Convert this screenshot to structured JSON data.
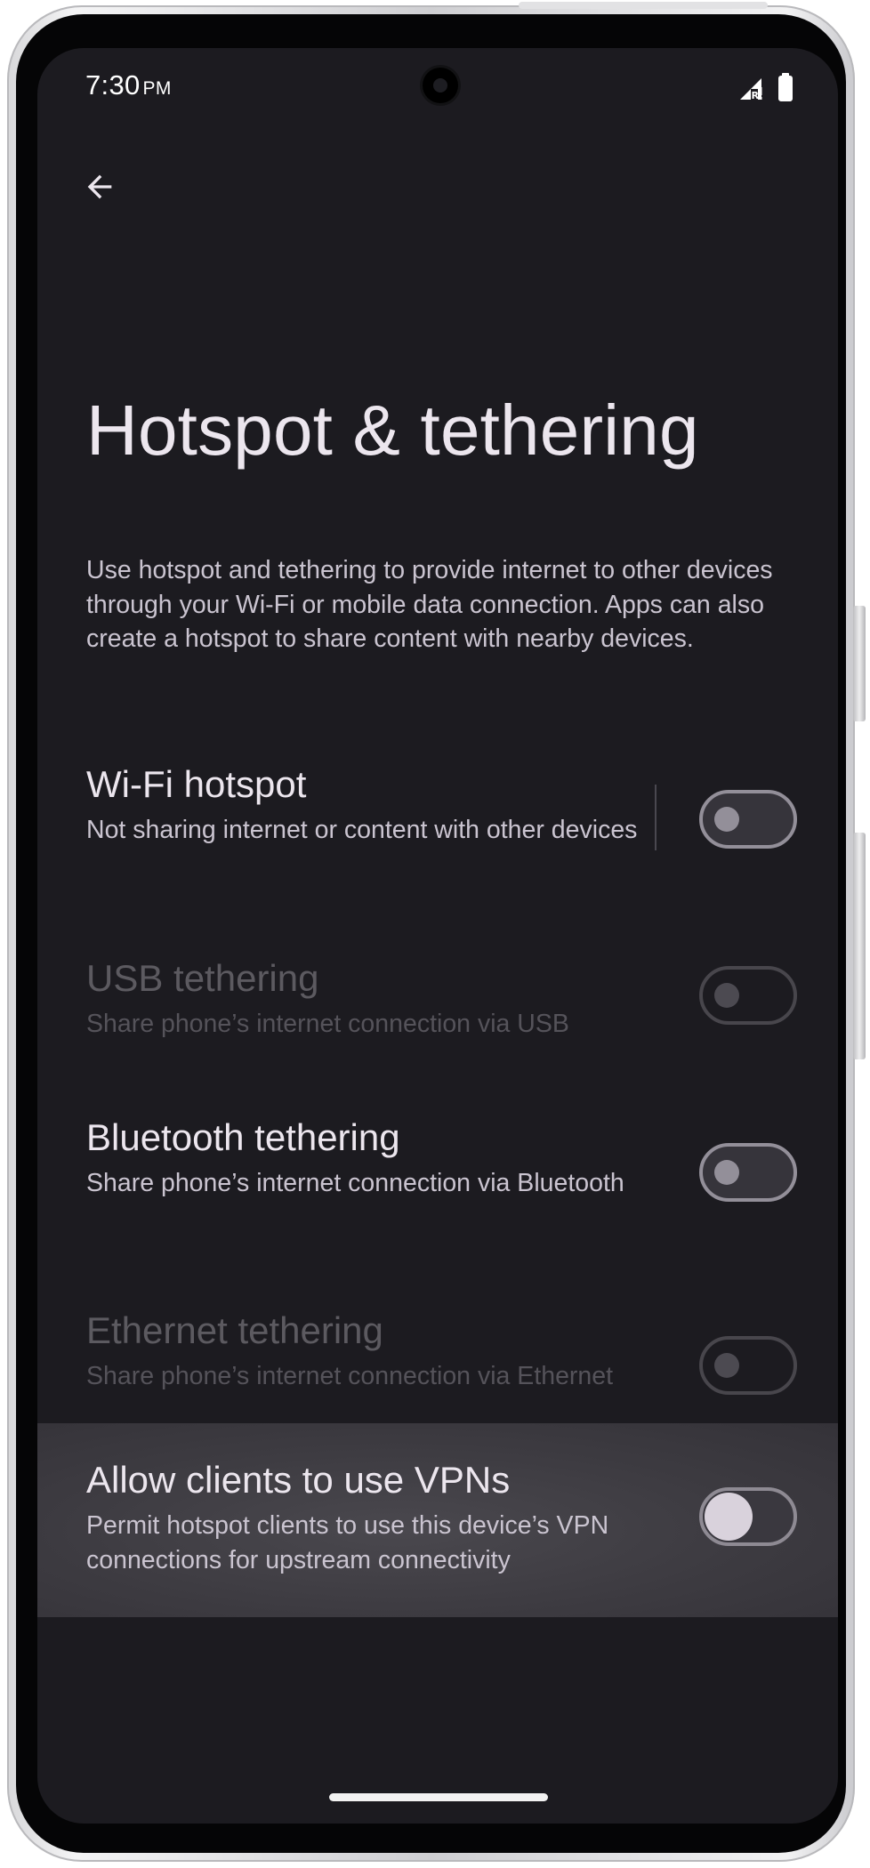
{
  "status_bar": {
    "time": "7:30",
    "ampm": "PM",
    "signal_icon": "cell-signal-roaming-icon",
    "battery_icon": "battery-full-icon"
  },
  "header": {
    "back_icon": "arrow-back-icon",
    "title": "Hotspot & tethering"
  },
  "description": "Use hotspot and tethering to provide internet to other devices through your Wi-Fi or mobile data connection. Apps can also create a hotspot to share content with nearby devices.",
  "settings": [
    {
      "title": "Wi-Fi hotspot",
      "subtitle": "Not sharing internet or content with other devices",
      "enabled": true,
      "checked": false
    },
    {
      "title": "USB tethering",
      "subtitle": "Share phone’s internet connection via USB",
      "enabled": false,
      "checked": false
    },
    {
      "title": "Bluetooth tethering",
      "subtitle": "Share phone’s internet connection via Bluetooth",
      "enabled": true,
      "checked": false
    },
    {
      "title": "Ethernet tethering",
      "subtitle": "Share phone’s internet connection via Ethernet",
      "enabled": false,
      "checked": false
    },
    {
      "title": "Allow clients to use VPNs",
      "subtitle": "Permit hotspot clients to use this device’s VPN connections for upstream connectivity",
      "enabled": true,
      "checked": false,
      "focused": true
    }
  ],
  "colors": {
    "background": "#1c1b20",
    "text_primary": "#ece6ee",
    "text_secondary": "#cac4d0",
    "text_disabled": "#5c5a60",
    "toggle_outline": "#938f99"
  }
}
